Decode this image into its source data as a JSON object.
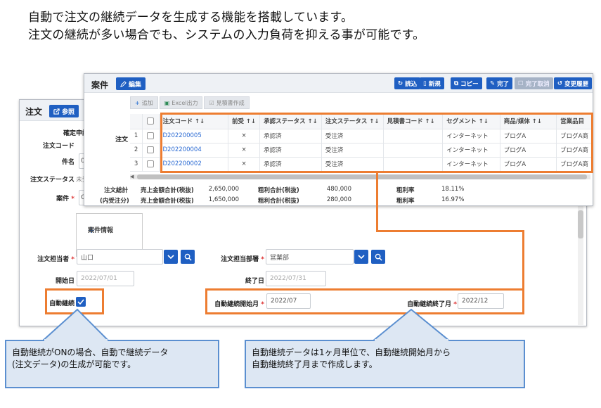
{
  "headline": {
    "line1": "自動で注文の継続データを生成する機能を搭載しています。",
    "line2": "注文の継続が多い場合でも、システムの入力負荷を抑える事が可能です。"
  },
  "order_window": {
    "title": "注文",
    "ref_button": "参照",
    "labels": {
      "confirm": "確定申請",
      "order_code": "注文コード",
      "subject": "件名",
      "order_status": "注文ステータス",
      "case": "案件",
      "person": "注文担当者",
      "dept": "注文担当部署",
      "start": "開始日",
      "end": "終了日",
      "auto": "自動継続",
      "auto_start": "自動継続開始月",
      "auto_end": "自動継続終了月"
    },
    "partial_values": {
      "confirm": "未",
      "subject": "0",
      "order_status": "未受",
      "case": "C"
    },
    "case_info": "案件情報",
    "values": {
      "person": "山口",
      "dept": "営業部",
      "start": "2022/07/01",
      "end": "2022/07/31",
      "auto_start": "2022/07",
      "auto_end": "2022/12"
    }
  },
  "case_window": {
    "title": "案件",
    "edit_button": "編集",
    "toolbar": [
      "読込",
      "新規",
      "コピー",
      "完了",
      "完了取消",
      "変更履歴"
    ],
    "subbar": [
      "追加",
      "Excel出力",
      "見積書作成"
    ],
    "side_label": "注文",
    "columns": [
      "注文コード ↑↓",
      "前受 ↑↓",
      "承認ステータス ↑↓",
      "注文ステータス ↑↓",
      "見積書コード ↑↓",
      "セグメント ↑↓",
      "商品/媒体 ↑↓",
      "営業品目"
    ],
    "rows": [
      {
        "no": "1",
        "code": "D202200005",
        "prepaid": "×",
        "approval": "承認済",
        "status": "受注済",
        "quote": "",
        "segment": "インターネット",
        "product": "ブログA",
        "item": "ブログA商"
      },
      {
        "no": "2",
        "code": "D202200004",
        "prepaid": "×",
        "approval": "承認済",
        "status": "受注済",
        "quote": "",
        "segment": "インターネット",
        "product": "ブログA",
        "item": "ブログA商"
      },
      {
        "no": "3",
        "code": "D202200002",
        "prepaid": "×",
        "approval": "承認済",
        "status": "受注済",
        "quote": "",
        "segment": "インターネット",
        "product": "ブログA",
        "item": "ブログA商"
      }
    ],
    "summary": {
      "total_label": "注文総計",
      "detail_label": "(内受注分)",
      "sales_label": "売上金額合計(税抜)",
      "sales_total": "2,650,000",
      "sales_detail": "1,650,000",
      "profit_label": "粗利合計(税抜)",
      "profit_total": "480,000",
      "profit_detail": "280,000",
      "rate_label": "粗利率",
      "rate_total": "18.11%",
      "rate_detail": "16.97%"
    }
  },
  "callouts": {
    "left": [
      "自動継続がONの場合、自動で継続データ",
      "(注文データ)の生成が可能です。"
    ],
    "right": [
      "自動継続データは1ヶ月単位で、自動継続開始月から",
      "自動継続終了月まで作成します。"
    ]
  },
  "colors": {
    "accent": "#1f5fc2",
    "highlight": "#ed7d31",
    "callout_bg": "#dde7f3"
  }
}
